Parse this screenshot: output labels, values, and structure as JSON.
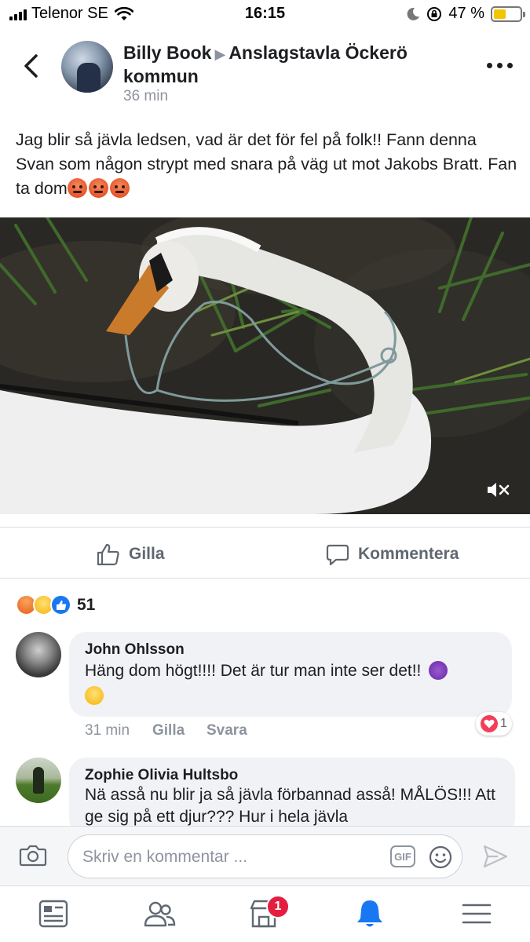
{
  "status_bar": {
    "carrier": "Telenor SE",
    "time": "16:15",
    "battery": "47 %",
    "battery_level": 0.47,
    "icons": [
      "signal-icon",
      "wifi-icon",
      "moon-icon",
      "rotation-lock-icon",
      "battery-icon"
    ]
  },
  "header": {
    "author": "Billy Book",
    "group": "Anslagstavla Öckerö kommun",
    "time": "36 min"
  },
  "post": {
    "text": "Jag blir så jävla ledsen, vad är det för fel på folk!! Fann denna Svan som någon strypt med snara på väg ut mot Jakobs Bratt. Fan ta dom",
    "emojis": [
      "angry-face",
      "angry-face",
      "angry-face"
    ]
  },
  "actions": {
    "like_label": "Gilla",
    "comment_label": "Kommentera"
  },
  "reactions": {
    "types": [
      "angry",
      "sad",
      "like"
    ],
    "count": "51"
  },
  "comments": [
    {
      "name": "John Ohlsson",
      "text_line1": "Häng dom högt!!!! Det är tur man inte ser det!!",
      "emojis": [
        "smiling-imp",
        "crying-face"
      ],
      "time": "31 min",
      "like_label": "Gilla",
      "reply_label": "Svara",
      "reaction_count": "1"
    },
    {
      "name": "Zophie Olivia Hultsbo",
      "text": "Nä asså nu blir ja så jävla förbannad asså! MÅLÖS!!! Att ge sig på ett djur??? Hur i hela jävla"
    }
  ],
  "composer": {
    "placeholder": "Skriv en kommentar ...",
    "gif_label": "GIF"
  },
  "tabbar": {
    "items": [
      "news-feed",
      "friends",
      "marketplace",
      "notifications",
      "menu"
    ],
    "marketplace_badge": "1"
  },
  "colors": {
    "accent": "#1877f2",
    "text": "#1c1e21",
    "muted": "#8d949e",
    "badge": "#e41e3f"
  }
}
